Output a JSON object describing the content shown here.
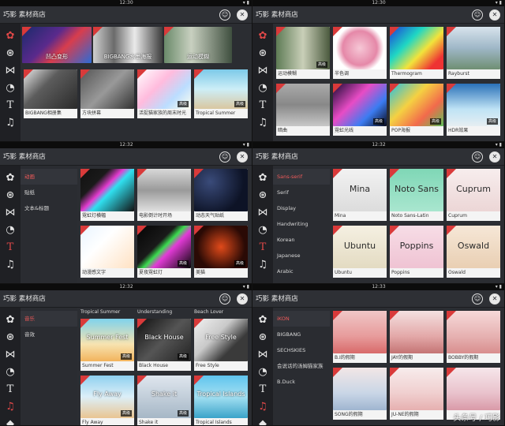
{
  "app_title": "巧影 素材商店",
  "colors": {
    "accent": "#e04848",
    "header": "#2e3035",
    "rail": "#1f2024"
  },
  "panels": [
    {
      "time": "12:30",
      "active_rail": 0,
      "categories": [],
      "tiles": [
        {
          "caption": "凹凸变形",
          "overlay": true,
          "bg": "linear-gradient(135deg,#1b2a6b,#5a2a8c 40%,#d83d4d 60%,#2c6bd6)"
        },
        {
          "caption": "BIGBANG水墨海报",
          "overlay": true,
          "bg": "linear-gradient(90deg,#cfcfcf,#6b6b6b 30%,#eaeaea 60%,#3c3c3c)"
        },
        {
          "caption": "运动模糊",
          "overlay": true,
          "bg": "linear-gradient(90deg,#6a8a6a,#c8d0c0 40%,#3f4f3f)"
        },
        {
          "caption": "BIGBANG相册集",
          "badge": "",
          "bg": "linear-gradient(135deg,#e8e8e8,#5c5c5c 40%,#2a2a2a)"
        },
        {
          "caption": "方块拼幕",
          "badge": "",
          "bg": "linear-gradient(135deg,#555,#999 50%,#333)"
        },
        {
          "caption": "活捉猫家族的周末时光",
          "badge": "高级",
          "bg": "linear-gradient(135deg,#fff,#fbd 40%,#bdf 70%,#ffe)"
        },
        {
          "caption": "Tropical Summer",
          "badge": "高级",
          "bg": "linear-gradient(180deg,#7cc9e8,#cdeef7 50%,#d9c7a0)"
        }
      ]
    },
    {
      "time": "12:30",
      "active_rail": 0,
      "categories": [],
      "tiles": [
        {
          "caption": "运动模糊",
          "badge": "高级",
          "bg": "linear-gradient(90deg,#5e7b55,#c9cfb8 50%,#4b5a3e)"
        },
        {
          "caption": "半色调",
          "badge": "",
          "bg": "radial-gradient(circle,#f6c7d6,#e588a8 50%,#fff 70%)"
        },
        {
          "caption": "Thermogram",
          "badge": "",
          "bg": "linear-gradient(135deg,#1d3ed8,#1fd7c4 35%,#f2e33b 60%,#e33 85%)"
        },
        {
          "caption": "Rayburst",
          "badge": "",
          "bg": "linear-gradient(180deg,#d7e3ec,#9fb7c7 50%,#6f8f73)"
        },
        {
          "caption": "暗曲",
          "badge": "",
          "bg": "linear-gradient(180deg,#aaa,#888 50%,#c8c8c8)"
        },
        {
          "caption": "霓虹光线",
          "badge": "高级",
          "bg": "linear-gradient(135deg,#1a0a33,#e84cc5 40%,#3b7cf2 70%,#0a0a1a)"
        },
        {
          "caption": "POP海报",
          "badge": "高级",
          "bg": "linear-gradient(135deg,#27c1e0,#f5d142 40%,#f26a4b 70%,#5dbf5a)"
        },
        {
          "caption": "HDR效果",
          "badge": "高级",
          "bg": "linear-gradient(180deg,#2a71b8,#bfe3f5 60%,#e6eef2)"
        }
      ]
    },
    {
      "time": "12:32",
      "active_rail": 4,
      "categories": [
        "动画",
        "贴纸",
        "文本&标题"
      ],
      "tiles": [
        {
          "caption": "霓虹灯横幅",
          "badge": "",
          "bg": "linear-gradient(135deg,#111,#1a1a1a 30%,#e43cd0 45%,#30e0f0 55%,#111)"
        },
        {
          "caption": "电影倒计时开场",
          "badge": "",
          "bg": "linear-gradient(180deg,#d8d8d8,#9a9a9a 50%,#e0e0e0)"
        },
        {
          "caption": "动态天气贴纸",
          "badge": "",
          "bg": "radial-gradient(circle at 30% 30%,#3a4b7a,#0d1326 70%)"
        },
        {
          "caption": "动漫感文字",
          "badge": "",
          "bg": "linear-gradient(135deg,#e8f4ff,#fff 40%,#ffe1c2)"
        },
        {
          "caption": "夏夜霓虹灯",
          "badge": "高级",
          "bg": "linear-gradient(135deg,#050505,#1a1a1a 40%,#3bdc4f 50%,#e23ad6 60%,#050505)"
        },
        {
          "caption": "美猫",
          "badge": "高级",
          "bg": "radial-gradient(circle,#e04a1a,#2a0a05 70%)"
        }
      ]
    },
    {
      "time": "12:32",
      "active_rail": 4,
      "categories": [
        "Sans-serif",
        "Serif",
        "Display",
        "Handwriting",
        "Korean",
        "Japanese",
        "Arabic"
      ],
      "tiles": [
        {
          "caption": "Mina",
          "badge": "",
          "font": "Mina",
          "bg": "linear-gradient(180deg,#f2f2f2,#dcdcdc)"
        },
        {
          "caption": "Noto Sans-Latin",
          "badge": "",
          "font": "Noto Sans",
          "bg": "linear-gradient(180deg,#7fd7b6,#a9e6cf)"
        },
        {
          "caption": "Cuprum",
          "badge": "",
          "font": "Cuprum",
          "bg": "linear-gradient(180deg,#f7eded,#ecd6d6)"
        },
        {
          "caption": "Ubuntu",
          "badge": "",
          "font": "Ubuntu",
          "bg": "linear-gradient(180deg,#f5f0e2,#e3dbc2)"
        },
        {
          "caption": "Poppins",
          "badge": "",
          "font": "Poppins",
          "bg": "linear-gradient(180deg,#f7dde6,#efc3d3)"
        },
        {
          "caption": "Oswald",
          "badge": "",
          "font": "Oswald",
          "bg": "linear-gradient(180deg,#f6e7d7,#e9cfb3)"
        }
      ]
    },
    {
      "time": "12:32",
      "active_rail": 5,
      "categories": [
        "音乐",
        "音效"
      ],
      "top_captions": [
        "Tropical Summer",
        "Understanding",
        "Beach Lover"
      ],
      "tiles": [
        {
          "caption": "Summer Fest",
          "badge": "高级",
          "label": "Summer Fest",
          "bg": "linear-gradient(180deg,#7fd2ec,#f7e3b0 60%,#f2b35c)"
        },
        {
          "caption": "Black House",
          "badge": "高级",
          "label": "Black House",
          "bg": "linear-gradient(135deg,#111,#555 50%,#222)"
        },
        {
          "caption": "Free Style",
          "badge": "",
          "label": "Free Style",
          "bg": "linear-gradient(135deg,#f1f1f1,#c9c9c9 40%,#3a3a3a 70%)"
        },
        {
          "caption": "Fly Away",
          "badge": "高级",
          "label": "Fly Away",
          "bg": "linear-gradient(180deg,#8fd0ef,#dceff8 50%,#e9c592)"
        },
        {
          "caption": "Shake it",
          "badge": "高级",
          "label": "Shake it",
          "bg": "linear-gradient(180deg,#dfe6ee,#a6b7c6)"
        },
        {
          "caption": "Tropical Islands",
          "badge": "",
          "label": "Tropical Islands",
          "bg": "linear-gradient(180deg,#5fc4ee,#a4e0f2 50%,#3aa3c9)"
        }
      ]
    },
    {
      "time": "12:33",
      "active_rail": 5,
      "categories": [
        "iKON",
        "BIGBANG",
        "SECHSKIES",
        "会说话的汤姆猫家族",
        "B.Duck"
      ],
      "tiles": [
        {
          "caption": "B.I的假期",
          "badge": "",
          "bg": "linear-gradient(180deg,#f0c7c7,#e79b9b 60%,#d86a6a)"
        },
        {
          "caption": "JAY的假期",
          "badge": "",
          "bg": "linear-gradient(180deg,#f4e0e0,#e3a8a8 60%,#c47474)"
        },
        {
          "caption": "BOBBY的假期",
          "badge": "",
          "bg": "linear-gradient(180deg,#f6d9d9,#e6b1b1 60%,#d88e8e)"
        },
        {
          "caption": "SONG的假期",
          "badge": "",
          "bg": "linear-gradient(180deg,#f2e6e6,#c9d6e6 60%,#9fb5d0)"
        },
        {
          "caption": "JU-NE的假期",
          "badge": "",
          "bg": "linear-gradient(180deg,#f7ecec,#f0cfcf 60%,#e6b0b0)"
        },
        {
          "caption": "",
          "badge": "",
          "bg": "linear-gradient(180deg,#f6e6ea,#e9c2cc 60%,#d99aa8)"
        }
      ]
    }
  ],
  "rail_icons": [
    "gear-icon",
    "effects-icon",
    "bowtie-icon",
    "sticker-icon",
    "text-icon",
    "music-icon",
    "diamond-icon"
  ],
  "watermark": "头条号 / 巧影"
}
